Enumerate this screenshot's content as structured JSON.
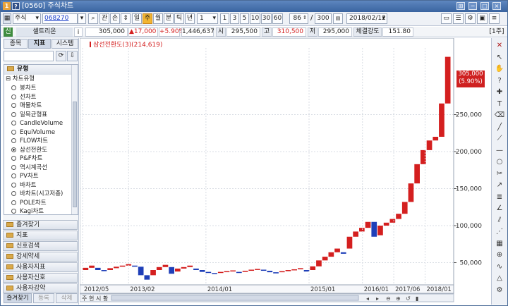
{
  "window": {
    "screen_no": "[0560]",
    "title": "주식차트",
    "icon1": "1",
    "icon2": "?",
    "pin_glyph": "⊞",
    "min_glyph": "─",
    "max_glyph": "□",
    "close_glyph": "×"
  },
  "toolbar": {
    "market": "주식",
    "code": "068270",
    "btn_gwan": "관",
    "btn_buy": "손",
    "btn_ud": "⇕",
    "periods": [
      "일",
      "주",
      "월",
      "분",
      "틱",
      "년"
    ],
    "active_period": "주",
    "interval": "1",
    "quick_intervals": [
      "1",
      "3",
      "5",
      "10",
      "30",
      "60"
    ],
    "count_visible": "86",
    "count_total": "300",
    "date": "2018/02/12",
    "right_icons": [
      "🗂",
      "📋",
      "⚙"
    ]
  },
  "infobar": {
    "badge": "신",
    "stock_name": "셀트리온",
    "info_btn": "i",
    "price": "305,000",
    "change": "▲17,000",
    "change_pct": "+5.90%",
    "volume": "1,446,637",
    "open_label": "시",
    "open": "295,500",
    "high_label": "고",
    "high": "310,500",
    "low_label": "저",
    "low": "295,000",
    "strength_label": "체결강도",
    "strength": "151.80",
    "period_tag": "1주"
  },
  "leftpanel": {
    "tabs": [
      "종목",
      "지표",
      "시스템"
    ],
    "active_tab": "지표",
    "tree_header": "유형",
    "tree_group": "차트유형",
    "chart_types": [
      "봉차트",
      "선차트",
      "매물차트",
      "일목균형표",
      "CandleVolume",
      "EquiVolume",
      "FLOW차트",
      "삼선전환도",
      "P&F차트",
      "역시계곡선",
      "PV차트",
      "바차트",
      "바차트(시고저종)",
      "POLE차트",
      "Kagi차트"
    ],
    "selected_type": "삼선전환도",
    "categories": [
      "즐겨찾기",
      "지표",
      "신호검색",
      "강세약세",
      "사용자지표",
      "사용자신호",
      "사용자강약"
    ],
    "bottom_tabs": [
      "즐겨찾기",
      "등록",
      "삭제"
    ]
  },
  "chart_data": {
    "type": "three-line-break",
    "legend": "삼선전환도(3)(214,619)",
    "last_price_label": "305,000",
    "last_change_label": "(5.90%)",
    "y_ticks": [
      50000,
      100000,
      150000,
      200000,
      250000
    ],
    "y_tick_labels": [
      "50,000",
      "100,000",
      "150,000",
      "200,000",
      "250,000"
    ],
    "ylim": [
      20000,
      340000
    ],
    "x_labels": [
      "2012/05",
      "2013/02",
      "2014/01",
      "2015/01",
      "2016/01",
      "2017/06",
      "2018/01"
    ],
    "bottom_buttons": [
      "주",
      "현",
      "시",
      "황"
    ],
    "colors": {
      "up": "#d41f1f",
      "down": "#1f3fb8",
      "grid": "#d9dde4"
    },
    "bricks": [
      {
        "d": "up",
        "low": 40000,
        "high": 43000
      },
      {
        "d": "up",
        "low": 43000,
        "high": 46000
      },
      {
        "d": "down",
        "low": 40000,
        "high": 43000
      },
      {
        "d": "down",
        "low": 38500,
        "high": 40000
      },
      {
        "d": "up",
        "low": 40000,
        "high": 42500
      },
      {
        "d": "up",
        "low": 42500,
        "high": 44500
      },
      {
        "d": "up",
        "low": 44500,
        "high": 46000
      },
      {
        "d": "up",
        "low": 46000,
        "high": 48000
      },
      {
        "d": "down",
        "low": 44500,
        "high": 46000
      },
      {
        "d": "down",
        "low": 33000,
        "high": 44500
      },
      {
        "d": "down",
        "low": 27000,
        "high": 33000
      },
      {
        "d": "up",
        "low": 33000,
        "high": 40000
      },
      {
        "d": "up",
        "low": 40000,
        "high": 44000
      },
      {
        "d": "up",
        "low": 44000,
        "high": 47000
      },
      {
        "d": "down",
        "low": 35000,
        "high": 44000
      },
      {
        "d": "up",
        "low": 38000,
        "high": 42000
      },
      {
        "d": "up",
        "low": 42000,
        "high": 44000
      },
      {
        "d": "up",
        "low": 44000,
        "high": 46000
      },
      {
        "d": "down",
        "low": 40000,
        "high": 42000
      },
      {
        "d": "down",
        "low": 37500,
        "high": 40000
      },
      {
        "d": "down",
        "low": 36000,
        "high": 37500
      },
      {
        "d": "down",
        "low": 35000,
        "high": 36000
      },
      {
        "d": "up",
        "low": 36000,
        "high": 37500
      },
      {
        "d": "up",
        "low": 37500,
        "high": 38500
      },
      {
        "d": "up",
        "low": 38500,
        "high": 39500
      },
      {
        "d": "down",
        "low": 36000,
        "high": 37500
      },
      {
        "d": "up",
        "low": 37500,
        "high": 39000
      },
      {
        "d": "up",
        "low": 39000,
        "high": 40500
      },
      {
        "d": "up",
        "low": 40500,
        "high": 41500
      },
      {
        "d": "down",
        "low": 39000,
        "high": 40500
      },
      {
        "d": "down",
        "low": 37000,
        "high": 39000
      },
      {
        "d": "down",
        "low": 35500,
        "high": 37000
      },
      {
        "d": "up",
        "low": 37000,
        "high": 38500
      },
      {
        "d": "up",
        "low": 38500,
        "high": 40000
      },
      {
        "d": "up",
        "low": 40000,
        "high": 41000
      },
      {
        "d": "up",
        "low": 41000,
        "high": 42500
      },
      {
        "d": "down",
        "low": 38000,
        "high": 40000
      },
      {
        "d": "up",
        "low": 40000,
        "high": 45000
      },
      {
        "d": "up",
        "low": 45000,
        "high": 53000
      },
      {
        "d": "up",
        "low": 53000,
        "high": 58000
      },
      {
        "d": "up",
        "low": 58000,
        "high": 64000
      },
      {
        "d": "up",
        "low": 64000,
        "high": 69000
      },
      {
        "d": "down",
        "low": 62000,
        "high": 64000
      },
      {
        "d": "up",
        "low": 69000,
        "high": 85000
      },
      {
        "d": "up",
        "low": 85000,
        "high": 92000
      },
      {
        "d": "up",
        "low": 92000,
        "high": 97000
      },
      {
        "d": "up",
        "low": 97000,
        "high": 105000
      },
      {
        "d": "down",
        "low": 85000,
        "high": 105000
      },
      {
        "d": "up",
        "low": 87000,
        "high": 100000
      },
      {
        "d": "up",
        "low": 100000,
        "high": 104000
      },
      {
        "d": "up",
        "low": 104000,
        "high": 109000
      },
      {
        "d": "up",
        "low": 109000,
        "high": 116000
      },
      {
        "d": "up",
        "low": 116000,
        "high": 132000
      },
      {
        "d": "up",
        "low": 132000,
        "high": 157000
      },
      {
        "d": "up",
        "low": 157000,
        "high": 183000
      },
      {
        "d": "up",
        "low": 183000,
        "high": 202000
      },
      {
        "d": "up",
        "low": 202000,
        "high": 215000
      },
      {
        "d": "up",
        "low": 215000,
        "high": 220000
      },
      {
        "d": "up",
        "low": 220000,
        "high": 265000
      },
      {
        "d": "up",
        "low": 265000,
        "high": 328000
      }
    ]
  },
  "righttools": {
    "icons": [
      "close-x",
      "cursor",
      "hand",
      "question",
      "cross",
      "text",
      "eraser",
      "line",
      "trend-line",
      "horizontal-line",
      "circle",
      "cut",
      "ray",
      "fibonacci",
      "angle",
      "channel",
      "gann",
      "grid",
      "zoom",
      "wave",
      "triangle",
      "gear"
    ]
  }
}
